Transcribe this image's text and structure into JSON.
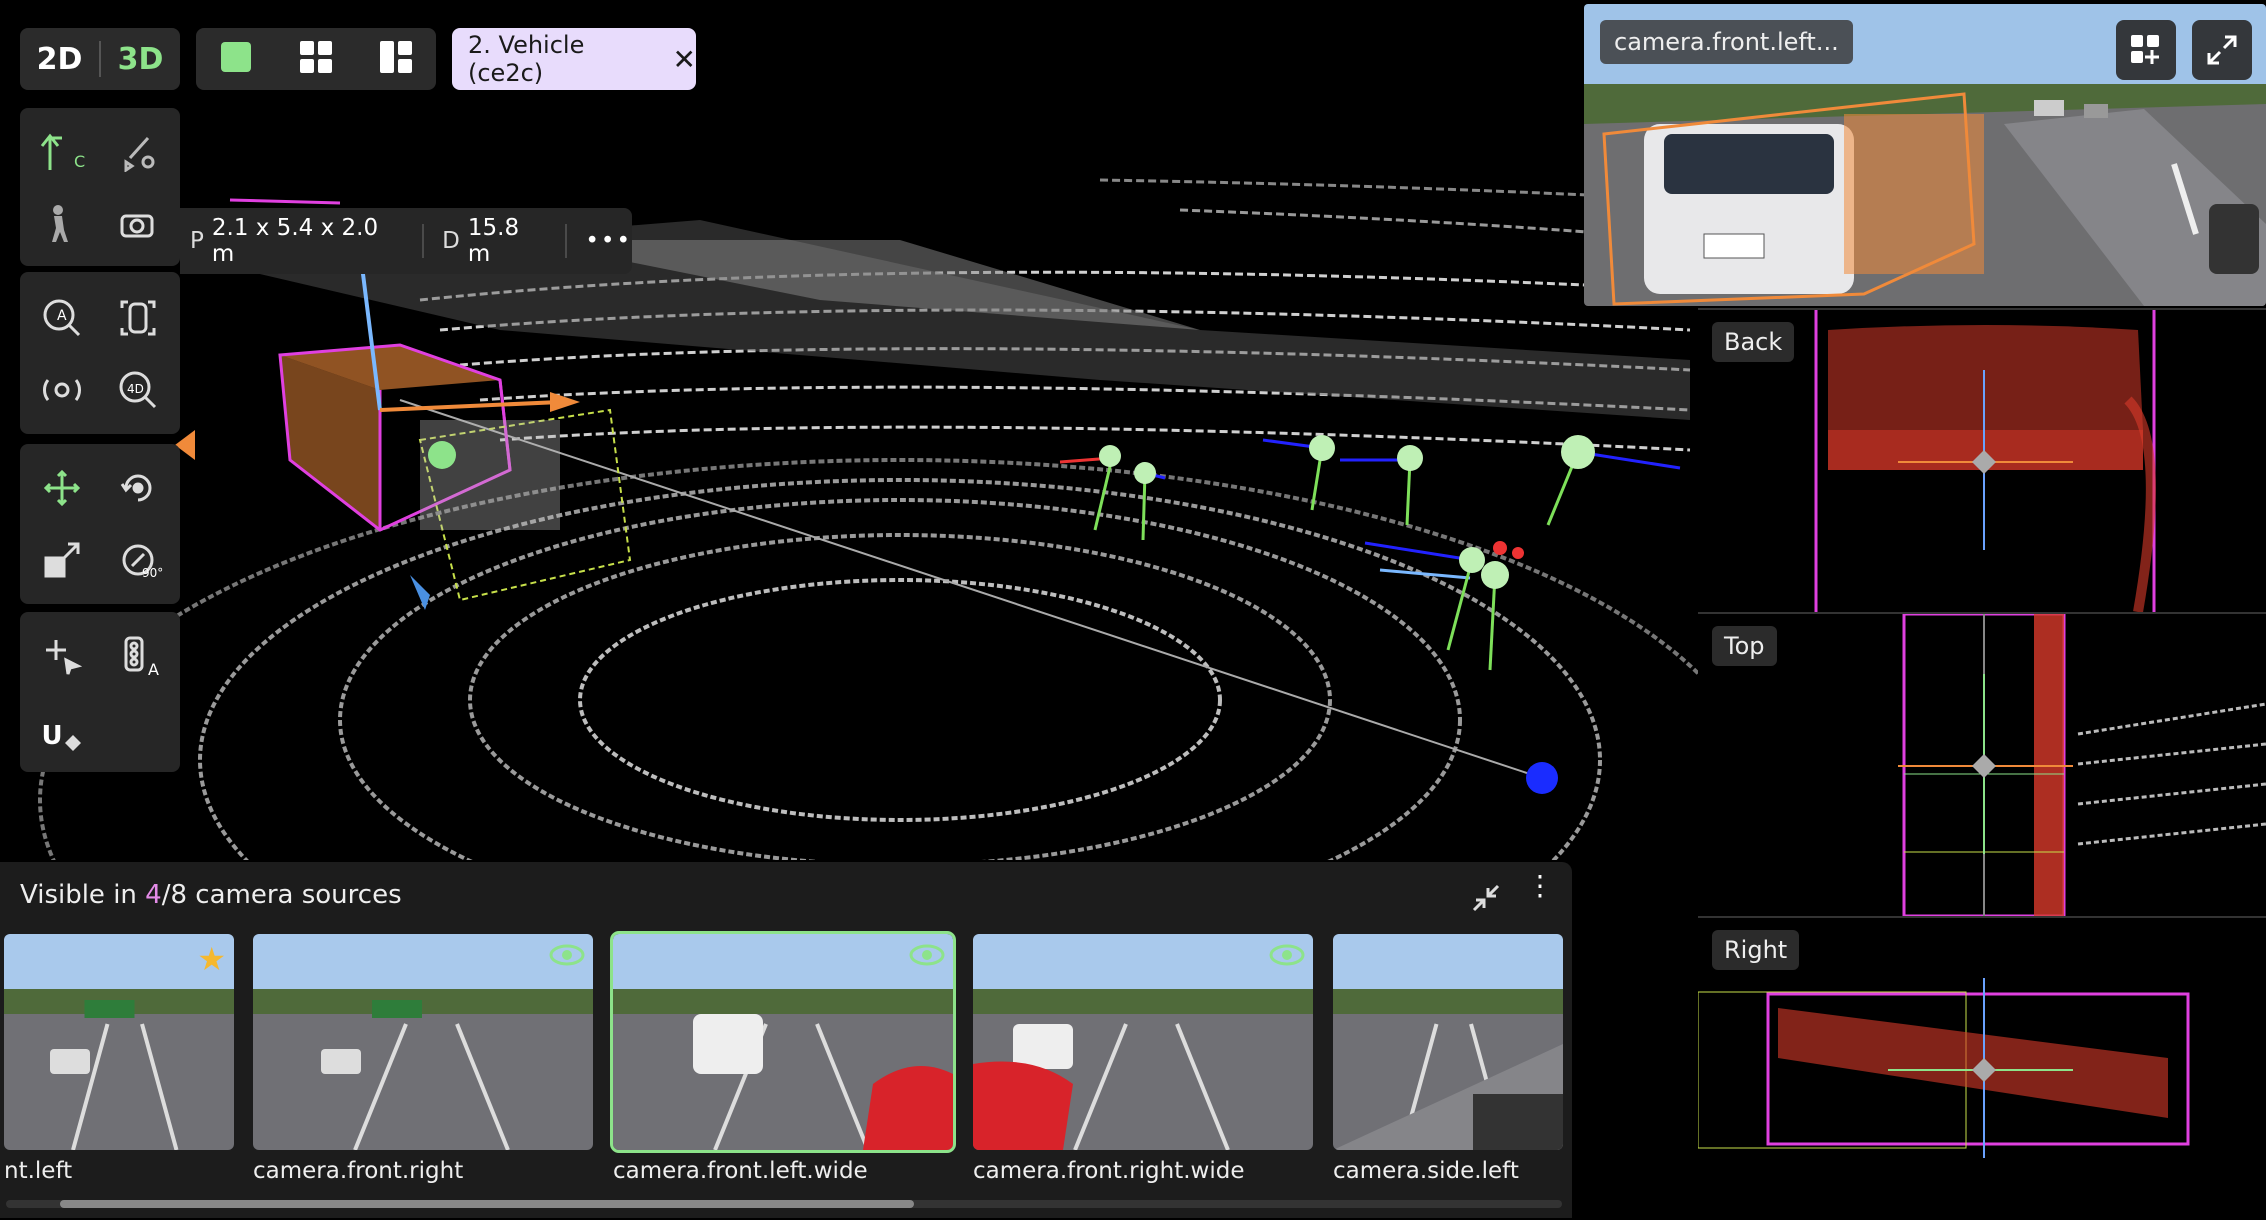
{
  "topbar": {
    "mode_2d": "2D",
    "mode_3d": "3D",
    "selection_chip": "2. Vehicle (ce2c)",
    "chip_close": "✕"
  },
  "measure": {
    "p_label": "P",
    "p_value": "2.1 x 5.4 x 2.0 m",
    "d_label": "D",
    "d_value": "15.8 m",
    "more": "•••"
  },
  "tools": {
    "cuboid_letter": "C",
    "auto_letter": "A",
    "zoom_a_letter": "A",
    "zoom_4d_letter": "4D",
    "rotate_90": "90°",
    "u_letter": "U"
  },
  "camera_panel": {
    "title_prefix": "Visible in ",
    "visible_count": "4",
    "title_suffix": "/8 camera sources",
    "thumbnails": [
      {
        "label": "camera.front.left",
        "display_label": "nt.left",
        "badge": "star"
      },
      {
        "label": "camera.front.right",
        "badge": "eye"
      },
      {
        "label": "camera.front.left.wide",
        "badge": "eye",
        "selected": true
      },
      {
        "label": "camera.front.right.wide",
        "badge": "eye"
      },
      {
        "label": "camera.side.left",
        "badge": "none"
      }
    ]
  },
  "main_camera": {
    "label": "camera.front.left..."
  },
  "ortho_views": {
    "back": "Back",
    "top": "Top",
    "right": "Right"
  },
  "colors": {
    "accent_green": "#8de38a",
    "chip_bg": "#e8dcfc",
    "cuboid_magenta": "#e040e0",
    "cuboid_orange": "#f08a3a",
    "highlight_pink": "#e48be8"
  }
}
